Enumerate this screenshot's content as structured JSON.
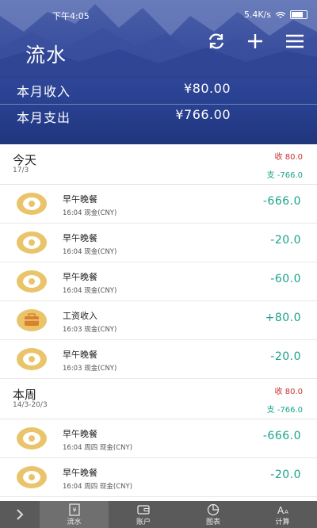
{
  "status_bar": {
    "time": "下午4:05",
    "network": "5.4K/s"
  },
  "header": {
    "title": "流水",
    "income_label": "本月收入",
    "income_value": "¥80.00",
    "expense_label": "本月支出",
    "expense_value": "¥766.00"
  },
  "groups": [
    {
      "name": "今天",
      "date": "17/3",
      "income": "收 80.0",
      "expense": "支 -766.0",
      "items": [
        {
          "icon": "egg-icon",
          "name": "早午晚餐",
          "meta": "16:04  现金(CNY)",
          "amount": "-666.0"
        },
        {
          "icon": "egg-icon",
          "name": "早午晚餐",
          "meta": "16:04  现金(CNY)",
          "amount": "-20.0"
        },
        {
          "icon": "egg-icon",
          "name": "早午晚餐",
          "meta": "16:04  现金(CNY)",
          "amount": "-60.0"
        },
        {
          "icon": "briefcase-icon",
          "name": "工资收入",
          "meta": "16:03  现金(CNY)",
          "amount": "+80.0"
        },
        {
          "icon": "egg-icon",
          "name": "早午晚餐",
          "meta": "16:03  现金(CNY)",
          "amount": "-20.0"
        }
      ]
    },
    {
      "name": "本周",
      "date": "14/3-20/3",
      "income": "收 80.0",
      "expense": "支 -766.0",
      "items": [
        {
          "icon": "egg-icon",
          "name": "早午晚餐",
          "meta": "16:04  周四  现金(CNY)",
          "amount": "-666.0"
        },
        {
          "icon": "egg-icon",
          "name": "早午晚餐",
          "meta": "16:04  周四  现金(CNY)",
          "amount": "-20.0"
        }
      ]
    }
  ],
  "tabbar": {
    "tabs": [
      {
        "label": "流水",
        "icon": "ledger-icon"
      },
      {
        "label": "账户",
        "icon": "wallet-icon"
      },
      {
        "label": "图表",
        "icon": "pie-chart-icon"
      },
      {
        "label": "计算",
        "icon": "font-size-icon"
      }
    ]
  },
  "colors": {
    "header_blue": "#2f4597",
    "income_red": "#c8302c",
    "expense_green": "#1aa38a",
    "icon_yellow": "#e9c46a",
    "tabbar_gray": "#5a5a5a"
  }
}
